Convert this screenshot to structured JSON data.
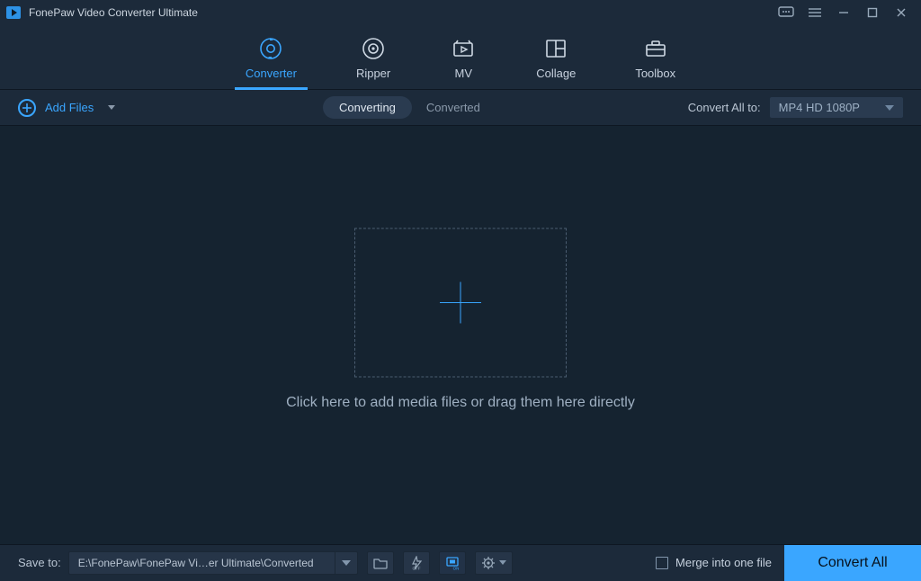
{
  "app": {
    "title": "FonePaw Video Converter Ultimate"
  },
  "nav": {
    "converter": "Converter",
    "ripper": "Ripper",
    "mv": "MV",
    "collage": "Collage",
    "toolbox": "Toolbox"
  },
  "toolbar": {
    "add_files": "Add Files",
    "converting": "Converting",
    "converted": "Converted",
    "convert_all_to_label": "Convert All to:",
    "format": "MP4 HD 1080P"
  },
  "work": {
    "hint": "Click here to add media files or drag them here directly"
  },
  "bottom": {
    "save_to_label": "Save to:",
    "save_to_path": "E:\\FonePaw\\FonePaw Vi…er Ultimate\\Converted",
    "merge_label": "Merge into one file",
    "convert_all": "Convert All"
  }
}
